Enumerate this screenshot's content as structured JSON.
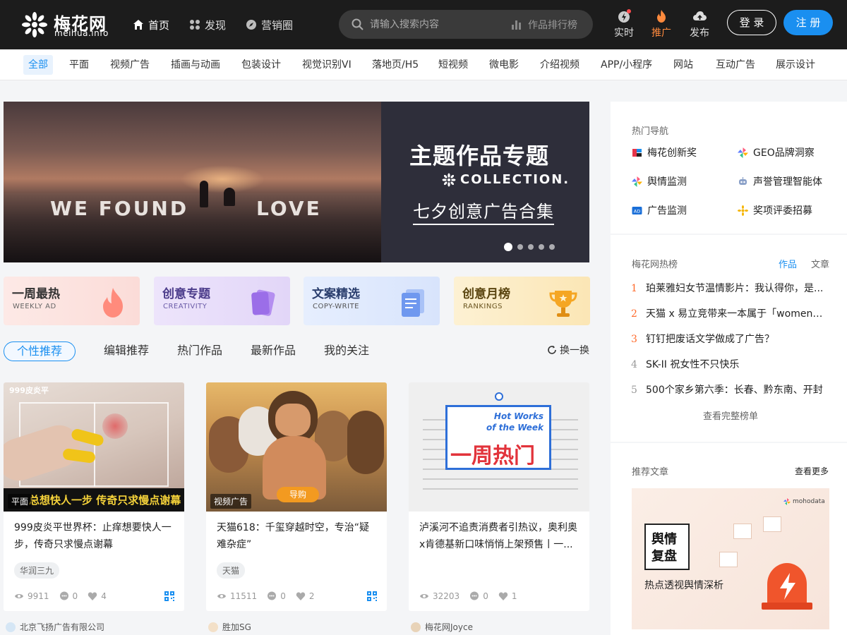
{
  "logo": {
    "name": "梅花网",
    "domain": "meihua.info"
  },
  "nav": {
    "items": [
      {
        "label": "首页",
        "icon": "home-icon"
      },
      {
        "label": "发现",
        "icon": "discover-icon"
      },
      {
        "label": "营销圈",
        "icon": "compass-icon"
      }
    ]
  },
  "search": {
    "placeholder": "请输入搜索内容",
    "rank_label": "作品排行榜"
  },
  "actions": {
    "realtime": "实时",
    "promote": "推广",
    "publish": "发布",
    "login": "登 录",
    "register": "注 册"
  },
  "categories": [
    "全部",
    "平面",
    "视频广告",
    "插画与动画",
    "包装设计",
    "视觉识别VI",
    "落地页/H5",
    "短视频",
    "微电影",
    "介绍视频",
    "APP/小程序",
    "网站",
    "互动广告",
    "展示设计"
  ],
  "banner": {
    "photo_text_left": "WE FOUND",
    "photo_text_right": "LOVE",
    "title": "主题作品专题",
    "collection": "COLLECTION.",
    "subtitle": "七夕创意广告合集",
    "dots": 5,
    "active_dot": 1
  },
  "features": [
    {
      "title": "一周最热",
      "sub": "WEEKLY AD",
      "color": "#fde6e3",
      "text_color": "#333"
    },
    {
      "title": "创意专题",
      "sub": "CREATIVITY",
      "color": "#ece5fb",
      "text_color": "#4b3b8a"
    },
    {
      "title": "文案精选",
      "sub": "COPY-WRITE",
      "color": "#e3ecfd",
      "text_color": "#333"
    },
    {
      "title": "创意月榜",
      "sub": "RANKINGS",
      "color": "#fdf0cf",
      "text_color": "#333"
    }
  ],
  "tabs": [
    "个性推荐",
    "编辑推荐",
    "热门作品",
    "最新作品",
    "我的关注"
  ],
  "refresh_label": "换一换",
  "cards": [
    {
      "thumb_text": "999皮炎平",
      "thumb_slogan": "总想快人一步 传奇只求慢点谢幕",
      "tag": "平面",
      "title": "999皮炎平世界杯：止痒想要快人一步，传奇只求慢点谢幕",
      "chip": "华润三九",
      "views": "9911",
      "comments": "0",
      "likes": "4",
      "author": "北京飞扬广告有限公司"
    },
    {
      "tag": "视频广告",
      "thumb_button": "导购",
      "title": "天猫618：千玺穿越时空，专治“疑难杂症”",
      "chip": "天猫",
      "views": "11511",
      "comments": "0",
      "likes": "2",
      "author": "胜加SG"
    },
    {
      "thumb_en1": "Hot Works",
      "thumb_en2": "of the Week",
      "thumb_cn": "一周热门",
      "title": "泸溪河不追责消费者引热议，奥利奥x肯德基新口味悄悄上架预售丨一...",
      "views": "32203",
      "comments": "0",
      "likes": "1",
      "author": "梅花网Joyce"
    }
  ],
  "sidebar": {
    "hot_nav_title": "热门导航",
    "hot_nav": [
      "梅花创新奖",
      "GEO品牌洞察",
      "舆情监测",
      "声誉管理智能体",
      "广告监测",
      "奖项评委招募"
    ],
    "rank_title": "梅花网热榜",
    "rank_tabs": [
      "作品",
      "文章"
    ],
    "rank": [
      "珀莱雅妇女节温情影片：我认得你，是...",
      "天猫 x 易立竞带来一本属于「women的...",
      "钉钉把废话文学做成了广告？",
      "SK-II 祝女性不只快乐",
      "500个家乡第六季：长春、黔东南、开封"
    ],
    "rank_more": "查看完整榜单",
    "articles_title": "推荐文章",
    "articles_more": "查看更多",
    "article": {
      "brand": "mohodata",
      "box_line1": "舆情",
      "box_line2": "复盘",
      "subtitle": "热点透视舆情深析"
    }
  },
  "colors": {
    "accent": "#1a8ff0",
    "topbar": "#1c1c1c",
    "rank_hot": "#ff6a2b"
  }
}
